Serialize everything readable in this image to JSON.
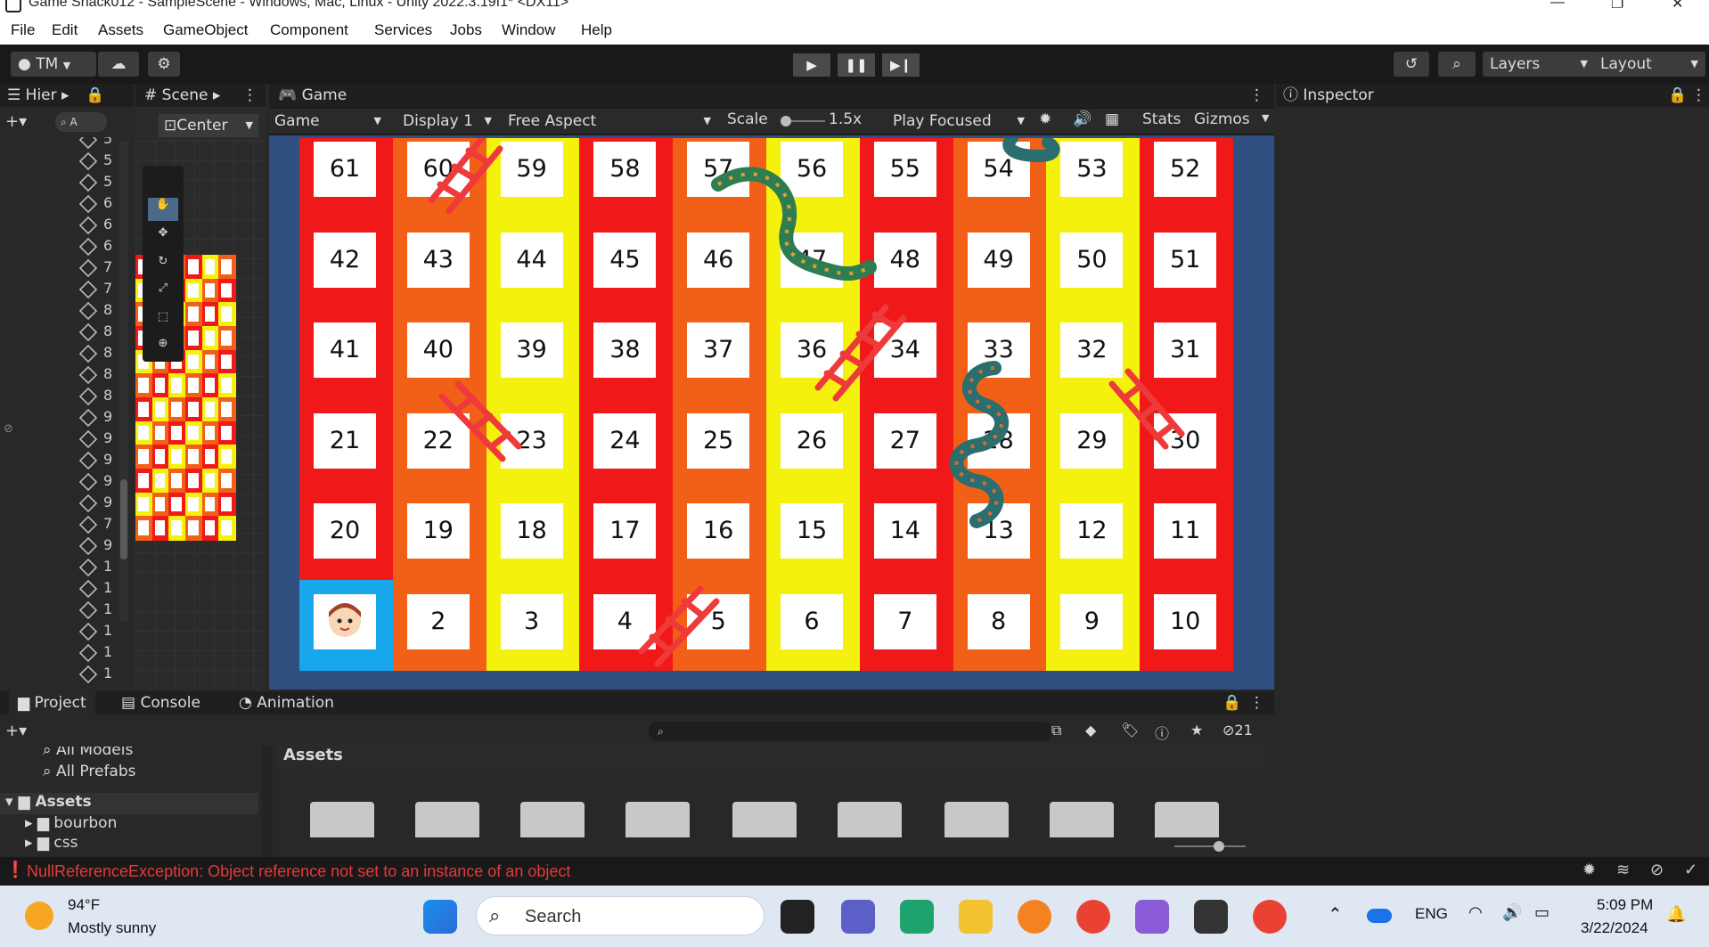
{
  "window": {
    "title": "Game Snack012 - SampleScene - Windows, Mac, Linux - Unity 2022.3.19f1* <DX11>"
  },
  "menu": [
    "File",
    "Edit",
    "Assets",
    "GameObject",
    "Component",
    "Services",
    "Jobs",
    "Window",
    "Help"
  ],
  "toolbar": {
    "account": "TM",
    "layers": "Layers",
    "layout": "Layout"
  },
  "hierarchy": {
    "tab": "Hier",
    "search_placeholder": "A",
    "rows": [
      "5",
      "5",
      "5",
      "6",
      "6",
      "6",
      "7",
      "7",
      "8",
      "8",
      "8",
      "8",
      "8",
      "9",
      "9",
      "9",
      "9",
      "9",
      "7",
      "9",
      "1",
      "1",
      "1",
      "1",
      "1",
      "1"
    ]
  },
  "scene": {
    "tab": "Scene",
    "pivot": "Center"
  },
  "game": {
    "tab": "Game",
    "mode": "Game",
    "display": "Display 1",
    "aspect": "Free Aspect",
    "scale_label": "Scale",
    "scale_value": "1.5x",
    "play_mode": "Play Focused",
    "stats": "Stats",
    "gizmos": "Gizmos"
  },
  "board": {
    "rows": [
      [
        61,
        60,
        59,
        58,
        57,
        56,
        55,
        54,
        53,
        52
      ],
      [
        42,
        43,
        44,
        45,
        46,
        47,
        48,
        49,
        50,
        51
      ],
      [
        41,
        40,
        39,
        38,
        37,
        36,
        34,
        33,
        32,
        31
      ],
      [
        21,
        22,
        23,
        24,
        25,
        26,
        27,
        28,
        29,
        30
      ],
      [
        20,
        19,
        18,
        17,
        16,
        15,
        14,
        13,
        12,
        11
      ],
      [
        "player",
        2,
        3,
        4,
        5,
        6,
        7,
        8,
        9,
        10
      ]
    ]
  },
  "inspector": {
    "tab": "Inspector"
  },
  "bottom": {
    "tabs": [
      "Project",
      "Console",
      "Animation"
    ],
    "favorites": [
      "All Models",
      "All Prefabs"
    ],
    "tree_root": "Assets",
    "tree_items": [
      "bourbon",
      "css"
    ],
    "breadcrumb": "Assets",
    "hidden_count": "21"
  },
  "status": {
    "error": "NullReferenceException: Object reference not set to an instance of an object"
  },
  "taskbar": {
    "weather_temp": "94°F",
    "weather_desc": "Mostly sunny",
    "search": "Search",
    "lang": "ENG",
    "time": "5:09 PM",
    "date": "3/22/2024"
  },
  "colors": {
    "red": "#f01818",
    "yellow": "#f4f20c",
    "orange": "#f26018",
    "blue_cell": "#17a7ea",
    "game_bg": "#2f4f80"
  }
}
